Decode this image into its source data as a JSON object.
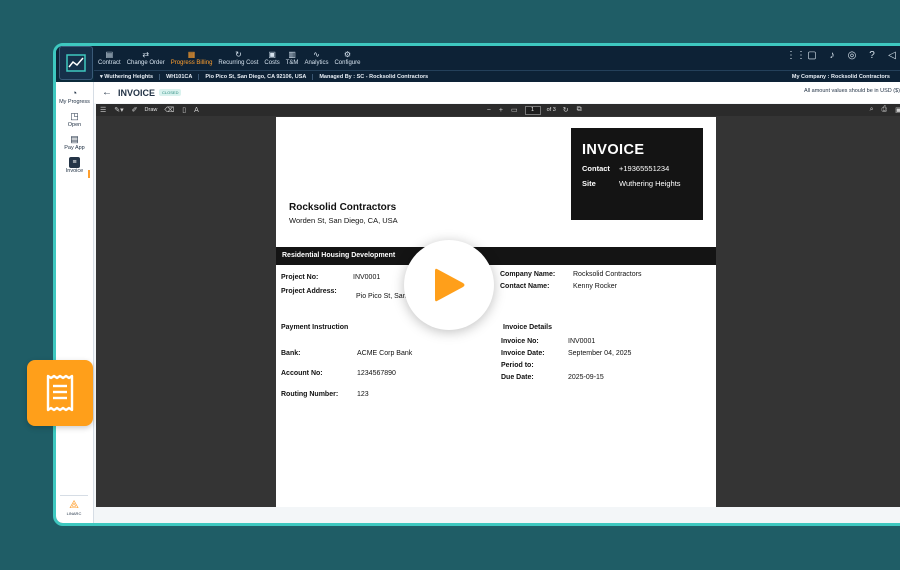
{
  "topnav": {
    "items": [
      {
        "label": "Contract",
        "icon": "contract-icon",
        "glyph": "▤"
      },
      {
        "label": "Change Order",
        "icon": "change-order-icon",
        "glyph": "⇄"
      },
      {
        "label": "Progress Billing",
        "icon": "progress-billing-icon",
        "glyph": "▦",
        "active": true
      },
      {
        "label": "Recurring Cost",
        "icon": "recurring-cost-icon",
        "glyph": "↻"
      },
      {
        "label": "Costs",
        "icon": "costs-icon",
        "glyph": "▣"
      },
      {
        "label": "T&M",
        "icon": "tm-icon",
        "glyph": "▥"
      },
      {
        "label": "Analytics",
        "icon": "analytics-icon",
        "glyph": "∿"
      },
      {
        "label": "Configure",
        "icon": "configure-icon",
        "glyph": "⚙"
      }
    ],
    "right_icons": [
      {
        "name": "apps-grid-icon",
        "glyph": "⋮⋮"
      },
      {
        "name": "chat-icon",
        "glyph": "▢"
      },
      {
        "name": "bell-icon",
        "glyph": "♪"
      },
      {
        "name": "eye-icon",
        "glyph": "◎"
      },
      {
        "name": "help-icon",
        "glyph": "?"
      },
      {
        "name": "announcement-icon",
        "glyph": "◁"
      }
    ]
  },
  "subbar": {
    "project": "▾ Wuthering Heights",
    "code": "WH101CA",
    "address": "Pio Pico St, San Diego, CA 92106, USA",
    "managed_by": "Managed By : SC - Rocksolid Contractors",
    "my_company": "My Company : Rocksolid Contractors"
  },
  "sidebar": {
    "items": [
      {
        "label": "My Progress",
        "icon": "dashboard-icon",
        "glyph": "◔"
      },
      {
        "label": "Open",
        "icon": "open-icon",
        "glyph": "◳"
      },
      {
        "label": "Pay App",
        "icon": "pay-app-icon",
        "glyph": "▤"
      },
      {
        "label": "Invoice",
        "icon": "invoice-icon",
        "glyph": "≡",
        "active": true
      }
    ],
    "brand": "LINARC"
  },
  "header": {
    "title": "INVOICE",
    "status": "CLOSED",
    "usd_note": "All amount values should be in USD ($)"
  },
  "toolbar": {
    "draw_label": "Draw",
    "page_current": "1",
    "page_total": "of 3"
  },
  "invoice": {
    "title": "INVOICE",
    "contact_label": "Contact",
    "contact_value": "+19365551234",
    "site_label": "Site",
    "site_value": "Wuthering Heights",
    "company": "Rocksolid Contractors",
    "company_address": "Worden St, San Diego, CA, USA",
    "project_band": "Residential Housing Development",
    "project_no_label": "Project No:",
    "project_no": "INV0001",
    "project_address_label": "Project Address:",
    "project_address": "Pio Pico St, San D",
    "company_name_label": "Company Name:",
    "company_name": "Rocksolid Contractors",
    "contact_name_label": "Contact Name:",
    "contact_name": "Kenny Rocker",
    "payment_title": "Payment Instruction",
    "bank_label": "Bank:",
    "bank": "ACME Corp Bank",
    "account_label": "Account No:",
    "account": "1234567890",
    "routing_label": "Routing Number:",
    "routing": "123",
    "details_title": "Invoice Details",
    "inv_no_label": "Invoice No:",
    "inv_no": "INV0001",
    "inv_date_label": "Invoice Date:",
    "inv_date": "September 04, 2025",
    "period_label": "Period to:",
    "due_label": "Due Date:",
    "due": "2025-09-15"
  },
  "colors": {
    "accent": "#ff9f1a",
    "nav_bg": "#0d2236",
    "frame": "#3ec8c0",
    "bg": "#1f5d66"
  }
}
